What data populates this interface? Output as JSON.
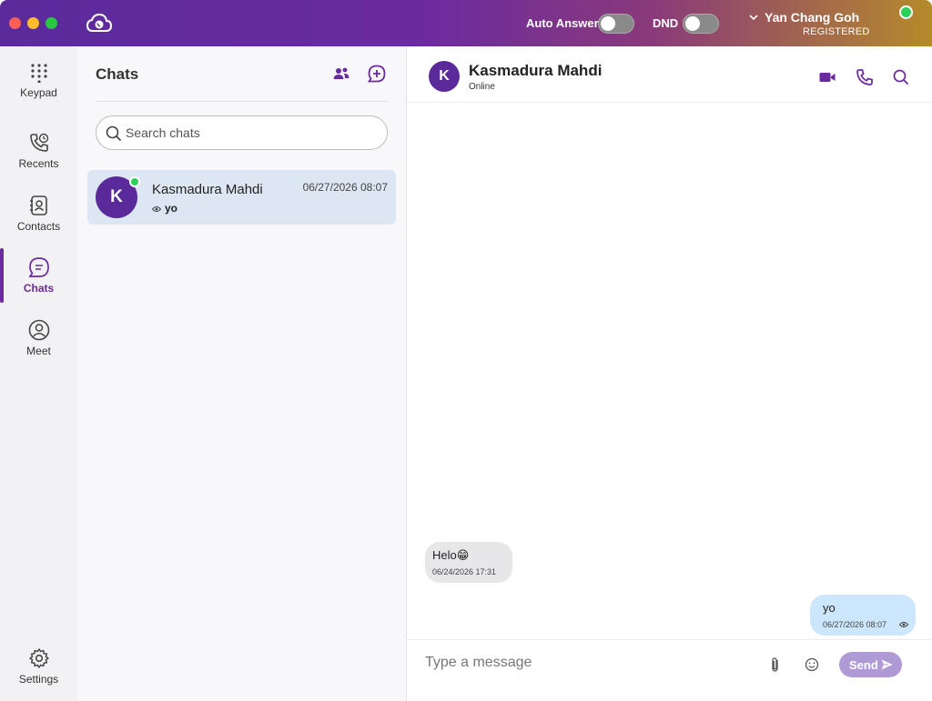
{
  "titlebar": {
    "auto_answer_label": "Auto Answer",
    "dnd_label": "DND",
    "user_name": "Yan Chang Goh",
    "user_status": "REGISTERED"
  },
  "nav": {
    "items": [
      {
        "label": "Keypad"
      },
      {
        "label": "Recents"
      },
      {
        "label": "Contacts"
      },
      {
        "label": "Chats"
      },
      {
        "label": "Meet"
      }
    ],
    "settings_label": "Settings",
    "active": "Chats"
  },
  "chat_list": {
    "title": "Chats",
    "search_placeholder": "Search chats",
    "rows": [
      {
        "initial": "K",
        "name": "Kasmadura Mahdi",
        "time": "06/27/2026 08:07",
        "preview": "yo"
      }
    ]
  },
  "conversation": {
    "initial": "K",
    "name": "Kasmadura Mahdi",
    "status": "Online",
    "messages": [
      {
        "direction": "in",
        "text": "Helo😁",
        "time": "06/24/2026 17:31"
      },
      {
        "direction": "out",
        "text": "yo",
        "time": "06/27/2026 08:07"
      }
    ],
    "composer_placeholder": "Type a message",
    "send_label": "Send"
  },
  "colors": {
    "brand": "#5a2a9b",
    "online": "#2bd15a",
    "selected_row": "#dce7f3",
    "outgoing_bubble": "#cce6fb",
    "send_button": "#b09ad6"
  }
}
